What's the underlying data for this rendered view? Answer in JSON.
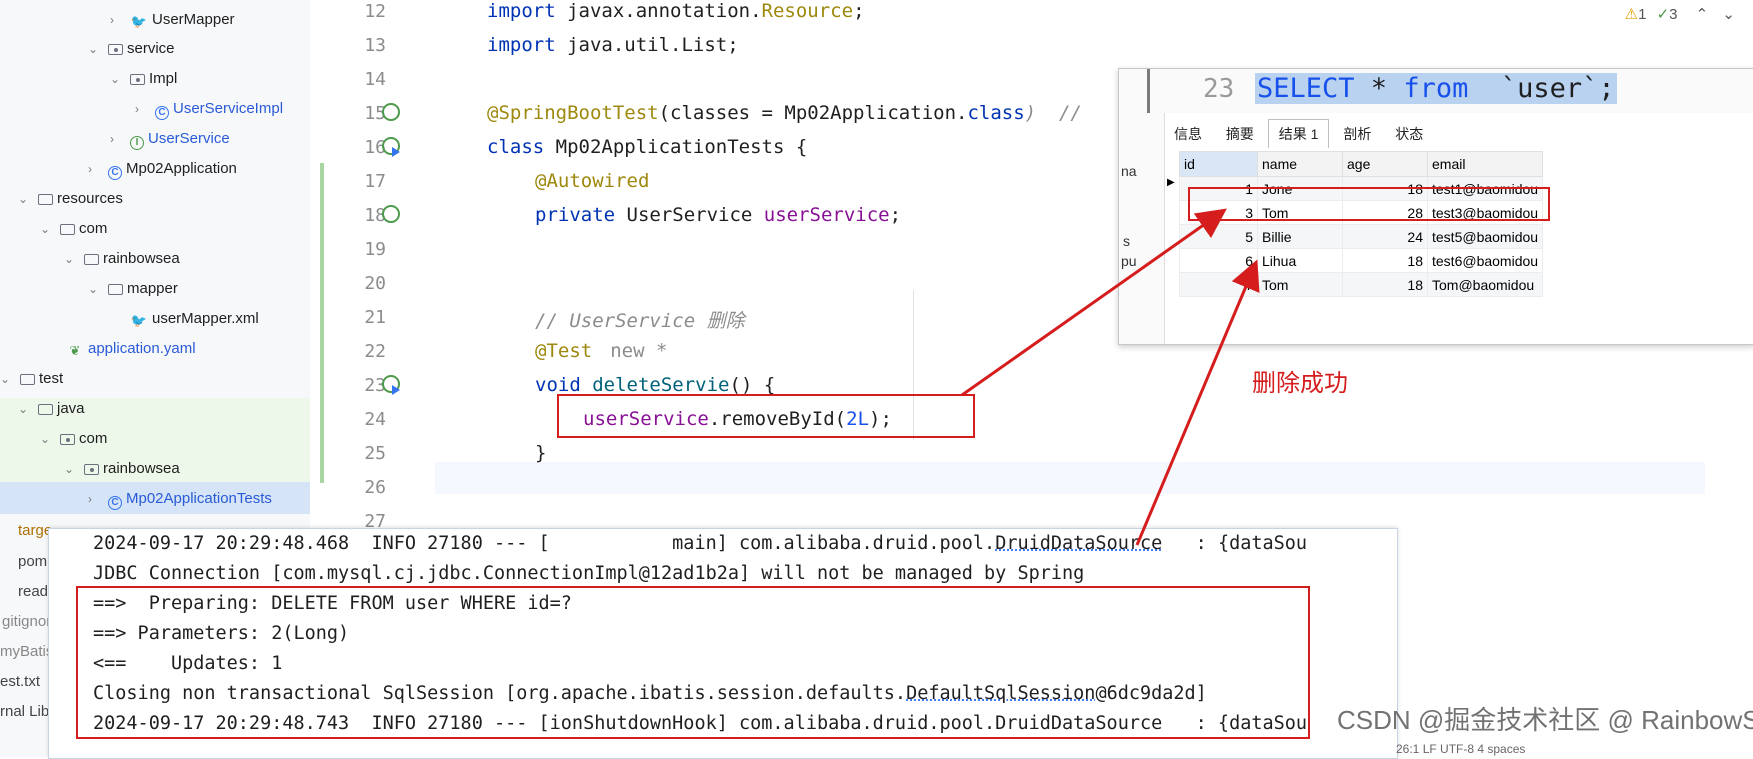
{
  "tree": {
    "items": [
      {
        "label": "UserMapper",
        "icon": "bird-icon",
        "blue": false
      },
      {
        "label": "service",
        "icon": "package-icon",
        "blue": false
      },
      {
        "label": "Impl",
        "icon": "package-icon",
        "blue": false
      },
      {
        "label": "UserServiceImpl",
        "icon": "class-icon",
        "blue": true
      },
      {
        "label": "UserService",
        "icon": "interface-icon",
        "blue": true
      },
      {
        "label": "Mp02Application",
        "icon": "spring-class-icon",
        "blue": false
      },
      {
        "label": "resources",
        "icon": "folder-icon",
        "blue": false
      },
      {
        "label": "com",
        "icon": "folder-icon",
        "blue": false
      },
      {
        "label": "rainbowsea",
        "icon": "folder-icon",
        "blue": false
      },
      {
        "label": "mapper",
        "icon": "folder-icon",
        "blue": false
      },
      {
        "label": "userMapper.xml",
        "icon": "bird-icon",
        "blue": false
      },
      {
        "label": "application.yaml",
        "icon": "leaf-icon",
        "blue": true
      },
      {
        "label": "test",
        "icon": "folder-icon",
        "blue": false
      },
      {
        "label": "java",
        "icon": "folder-icon",
        "blue": false
      },
      {
        "label": "com",
        "icon": "package-icon",
        "blue": false
      },
      {
        "label": "rainbowsea",
        "icon": "package-icon",
        "blue": false
      },
      {
        "label": "Mp02ApplicationTests",
        "icon": "test-class-icon",
        "blue": true
      }
    ],
    "bottom_items": [
      "targe",
      "pom",
      "readi",
      "gitignor",
      "myBatis",
      "est.txt",
      "rnal Lib"
    ]
  },
  "inspections": {
    "warnings": "1",
    "checks": "3"
  },
  "editor": {
    "line_numbers": [
      "12",
      "13",
      "14",
      "15",
      "16",
      "17",
      "18",
      "19",
      "20",
      "21",
      "22",
      "23",
      "24",
      "25",
      "26",
      "27"
    ],
    "lines": {
      "l12": {
        "kw": "import",
        "rest": " javax.annotation.",
        "cls": "Resource",
        "end": ";"
      },
      "l13": {
        "kw": "import",
        "rest": " java.util.List;"
      },
      "l15": {
        "ann": "@SpringBootTest",
        "rest": "(classes = Mp02Application.",
        "kw": "class",
        "end": ")  //"
      },
      "l16": {
        "kw": "class",
        "rest": " Mp02ApplicationTests {"
      },
      "l17": {
        "ann": "@Autowired"
      },
      "l18": {
        "kw": "private",
        "rest": " UserService ",
        "fld": "userService",
        "end": ";"
      },
      "l21": {
        "cmt": "// UserService 删除"
      },
      "l22": {
        "ann": "@Test",
        "hint": "new *"
      },
      "l23": {
        "kw": "void",
        "method": "deleteServie",
        "rest": "() {"
      },
      "l24": {
        "fld": "userService",
        "rest": ".removeById(",
        "num": "2L",
        "end": ");"
      },
      "l25": {
        "rest": "}"
      }
    }
  },
  "db": {
    "sql_line_no": "23",
    "sql_select": "SELECT",
    "sql_star": " * ",
    "sql_from": "from",
    "sql_table": "  `user`;",
    "tabs": [
      "信息",
      "摘要",
      "结果 1",
      "剖析",
      "状态"
    ],
    "left_strip": [
      "na",
      "s",
      "pu"
    ],
    "columns": [
      "id",
      "name",
      "age",
      "email"
    ],
    "rows": [
      [
        "1",
        "Jone",
        "18",
        "test1@baomidou"
      ],
      [
        "3",
        "Tom",
        "28",
        "test3@baomidou"
      ],
      [
        "5",
        "Billie",
        "24",
        "test5@baomidou"
      ],
      [
        "6",
        "Lihua",
        "18",
        "test6@baomidou"
      ],
      [
        "7",
        "Tom",
        "18",
        "Tom@baomidou"
      ]
    ]
  },
  "console": {
    "l1": "2024-09-17 20:29:48.468  INFO 27180 --- [           main] com.alibaba.druid.pool.",
    "l1_link": "DruidDataSource",
    "l1_end": "   : {dataSou",
    "l2": "JDBC Connection [com.mysql.cj.jdbc.ConnectionImpl@12ad1b2a] will not be managed by Spring",
    "l3": "==>  Preparing: DELETE FROM user WHERE id=?",
    "l4": "==> Parameters: 2(Long)",
    "l5": "<==    Updates: 1",
    "l6": "Closing non transactional SqlSession [org.apache.ibatis.session.defaults.",
    "l6_link": "DefaultSqlSession",
    "l6_end": "@6dc9da2d]",
    "l7": "2024-09-17 20:29:48.743  INFO 27180 --- [ionShutdownHook] com.alibaba.druid.pool.DruidDataSource   : {dataSou"
  },
  "annotation": {
    "note": "删除成功",
    "color": "#d51d1d"
  },
  "watermark": "CSDN @掘金技术社区 @ RainbowSea",
  "statusbar": "26:1    LF    UTF-8    4 spaces"
}
